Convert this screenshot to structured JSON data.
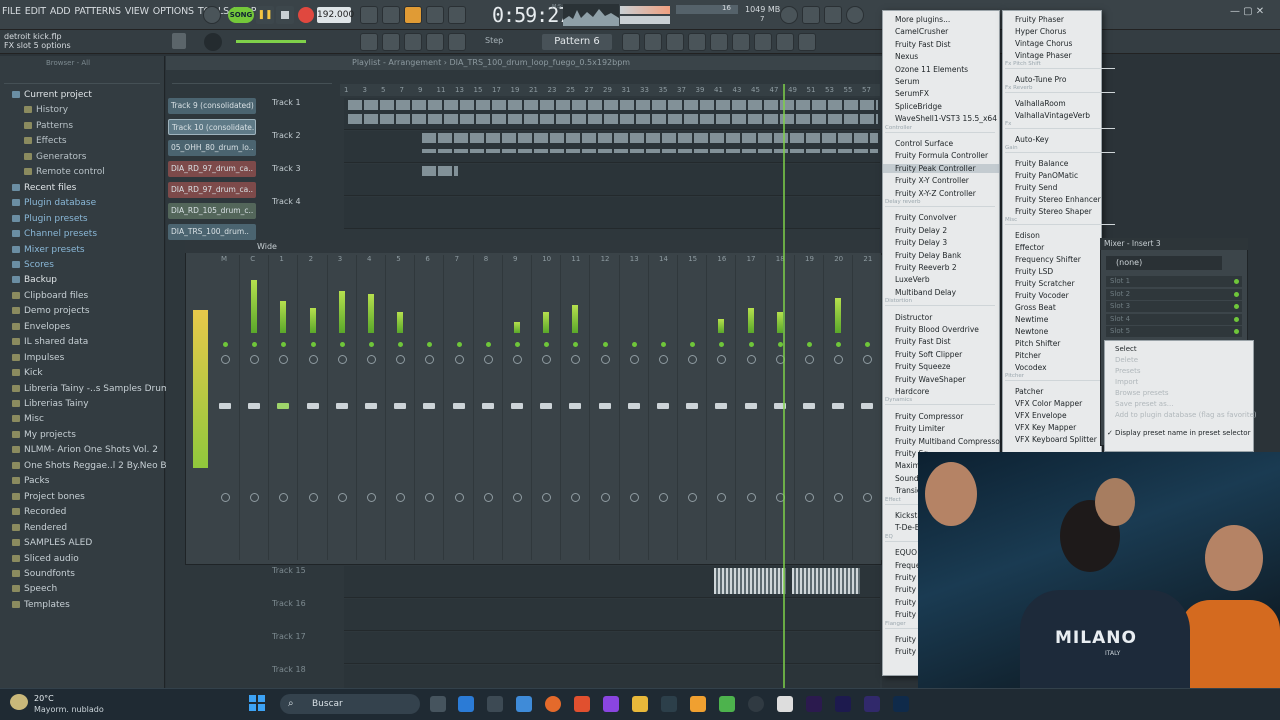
{
  "menu": [
    "FILE",
    "EDIT",
    "ADD",
    "PATTERNS",
    "VIEW",
    "OPTIONS",
    "TOOLS",
    "HELP"
  ],
  "transport": {
    "song_label": "SONG",
    "tempo": "192.000",
    "time": "0:59:27",
    "time_unit": "M:S:CS",
    "memory": "1049 MB",
    "cpu": "16",
    "voices": "7"
  },
  "hints": {
    "line1": "detroit kick.flp",
    "line2": "FX slot 5 options"
  },
  "toolbar": {
    "step_label": "Step",
    "pattern": "Pattern 6"
  },
  "browser": {
    "header": "Browser - All",
    "items": [
      {
        "label": "Current project",
        "type": "top"
      },
      {
        "label": "History",
        "type": "sub"
      },
      {
        "label": "Patterns",
        "type": "sub"
      },
      {
        "label": "Effects",
        "type": "sub"
      },
      {
        "label": "Generators",
        "type": "sub"
      },
      {
        "label": "Remote control",
        "type": "sub"
      },
      {
        "label": "Recent files",
        "type": "top"
      },
      {
        "label": "Plugin database",
        "type": "blue"
      },
      {
        "label": "Plugin presets",
        "type": "blue"
      },
      {
        "label": "Channel presets",
        "type": "blue"
      },
      {
        "label": "Mixer presets",
        "type": "blue"
      },
      {
        "label": "Scores",
        "type": "blue"
      },
      {
        "label": "Backup",
        "type": "top"
      },
      {
        "label": "Clipboard files",
        "type": "item"
      },
      {
        "label": "Demo projects",
        "type": "item"
      },
      {
        "label": "Envelopes",
        "type": "item"
      },
      {
        "label": "IL shared data",
        "type": "item"
      },
      {
        "label": "Impulses",
        "type": "item"
      },
      {
        "label": "Kick",
        "type": "item"
      },
      {
        "label": "Libreria Tainy -..s Samples Drum Kit",
        "type": "item"
      },
      {
        "label": "Librerias Tainy",
        "type": "item"
      },
      {
        "label": "Misc",
        "type": "item"
      },
      {
        "label": "My projects",
        "type": "item"
      },
      {
        "label": "NLMM- Arion One Shots Vol. 2",
        "type": "item"
      },
      {
        "label": "One Shots Reggae..l 2 By.Neo Beats",
        "type": "item"
      },
      {
        "label": "Packs",
        "type": "item"
      },
      {
        "label": "Project bones",
        "type": "item"
      },
      {
        "label": "Recorded",
        "type": "item"
      },
      {
        "label": "Rendered",
        "type": "item"
      },
      {
        "label": "SAMPLES ALED",
        "type": "item"
      },
      {
        "label": "Sliced audio",
        "type": "item"
      },
      {
        "label": "Soundfonts",
        "type": "item"
      },
      {
        "label": "Speech",
        "type": "item"
      },
      {
        "label": "Templates",
        "type": "item"
      }
    ]
  },
  "playlist": {
    "title": "Playlist - Arrangement",
    "file": "DIA_TRS_100_drum_loop_fuego_0.5x192bpm",
    "clips": [
      {
        "label": "Track 9 (consolidated)",
        "color": "blue"
      },
      {
        "label": "Track 10 (consolidate..",
        "color": "sel"
      },
      {
        "label": "05_OHH_80_drum_lo..",
        "color": "blue"
      },
      {
        "label": "DIA_RD_97_drum_ca..",
        "color": "red"
      },
      {
        "label": "DIA_RD_97_drum_ca..",
        "color": "red"
      },
      {
        "label": "DIA_RD_105_drum_c..",
        "color": "green"
      },
      {
        "label": "DIA_TRS_100_drum..",
        "color": "blue"
      }
    ],
    "tracks": [
      "Track 1",
      "Track 2",
      "Track 3",
      "Track 4"
    ],
    "lower_tracks": [
      "Track 15",
      "Track 16",
      "Track 17",
      "Track 18"
    ],
    "ruler": [
      "1",
      "3",
      "5",
      "7",
      "9",
      "11",
      "13",
      "15",
      "17",
      "19",
      "21",
      "23",
      "25",
      "27",
      "29",
      "31",
      "33",
      "35",
      "37",
      "39",
      "41",
      "43",
      "45",
      "47",
      "49",
      "51",
      "53",
      "55",
      "57"
    ]
  },
  "mixer": {
    "mode": "Wide",
    "strip_labels": [
      "M",
      "C",
      "1",
      "2",
      "3",
      "4",
      "5",
      "6",
      "7",
      "8",
      "9",
      "10",
      "11",
      "12",
      "13",
      "14",
      "15",
      "16",
      "17",
      "18",
      "19",
      "20",
      "21",
      "22"
    ]
  },
  "plugin_menu": {
    "col1": [
      {
        "label": "More plugins...",
        "type": "item"
      },
      {
        "label": "CamelCrusher",
        "type": "item"
      },
      {
        "label": "Fruity Fast Dist",
        "type": "item"
      },
      {
        "label": "Nexus",
        "type": "item"
      },
      {
        "label": "Ozone 11 Elements",
        "type": "item"
      },
      {
        "label": "Serum",
        "type": "item"
      },
      {
        "label": "SerumFX",
        "type": "item"
      },
      {
        "label": "SpliceBridge",
        "type": "item"
      },
      {
        "label": "WaveShell1-VST3 15.5_x64",
        "type": "item"
      },
      {
        "label": "Controller",
        "type": "sep"
      },
      {
        "label": "Control Surface",
        "type": "item"
      },
      {
        "label": "Fruity Formula Controller",
        "type": "item"
      },
      {
        "label": "Fruity Peak Controller",
        "type": "hl"
      },
      {
        "label": "Fruity X-Y Controller",
        "type": "item"
      },
      {
        "label": "Fruity X-Y-Z Controller",
        "type": "item"
      },
      {
        "label": "Delay reverb",
        "type": "sep"
      },
      {
        "label": "Fruity Convolver",
        "type": "item"
      },
      {
        "label": "Fruity Delay 2",
        "type": "item"
      },
      {
        "label": "Fruity Delay 3",
        "type": "item"
      },
      {
        "label": "Fruity Delay Bank",
        "type": "item"
      },
      {
        "label": "Fruity Reeverb 2",
        "type": "item"
      },
      {
        "label": "LuxeVerb",
        "type": "item"
      },
      {
        "label": "Multiband Delay",
        "type": "item"
      },
      {
        "label": "Distortion",
        "type": "sep"
      },
      {
        "label": "Distructor",
        "type": "item"
      },
      {
        "label": "Fruity Blood Overdrive",
        "type": "item"
      },
      {
        "label": "Fruity Fast Dist",
        "type": "item"
      },
      {
        "label": "Fruity Soft Clipper",
        "type": "item"
      },
      {
        "label": "Fruity Squeeze",
        "type": "item"
      },
      {
        "label": "Fruity WaveShaper",
        "type": "item"
      },
      {
        "label": "Hardcore",
        "type": "item"
      },
      {
        "label": "Dynamics",
        "type": "sep"
      },
      {
        "label": "Fruity Compressor",
        "type": "item"
      },
      {
        "label": "Fruity Limiter",
        "type": "item"
      },
      {
        "label": "Fruity Multiband Compressor",
        "type": "item"
      },
      {
        "label": "Fruity Sq..",
        "type": "item"
      },
      {
        "label": "Maximus",
        "type": "item"
      },
      {
        "label": "Soundgo..",
        "type": "item"
      },
      {
        "label": "Transient..",
        "type": "item"
      },
      {
        "label": "Effect",
        "type": "sep"
      },
      {
        "label": "Kickstart..",
        "type": "item"
      },
      {
        "label": "T-De-Ess..",
        "type": "item"
      },
      {
        "label": "EQ",
        "type": "sep"
      },
      {
        "label": "EQUO",
        "type": "item"
      },
      {
        "label": "Frequen..",
        "type": "item"
      },
      {
        "label": "Fruity Fi..",
        "type": "item"
      },
      {
        "label": "Fruity Lo..",
        "type": "item"
      },
      {
        "label": "Fruity Pa..",
        "type": "item"
      },
      {
        "label": "Fruity Pa..",
        "type": "item"
      },
      {
        "label": "Flanger",
        "type": "sep"
      },
      {
        "label": "Fruity Fl..",
        "type": "item"
      },
      {
        "label": "Fruity Fl..",
        "type": "item"
      }
    ],
    "col2": [
      {
        "label": "Fruity Phaser",
        "type": "item"
      },
      {
        "label": "Hyper Chorus",
        "type": "item"
      },
      {
        "label": "Vintage Chorus",
        "type": "item"
      },
      {
        "label": "Vintage Phaser",
        "type": "item"
      },
      {
        "label": "Fx Pitch Shift",
        "type": "sep"
      },
      {
        "label": "Auto-Tune Pro",
        "type": "item"
      },
      {
        "label": "Fx Reverb",
        "type": "sep"
      },
      {
        "label": "ValhallaRoom",
        "type": "item"
      },
      {
        "label": "ValhallaVintageVerb",
        "type": "item"
      },
      {
        "label": "Fx",
        "type": "sep"
      },
      {
        "label": "Auto-Key",
        "type": "item"
      },
      {
        "label": "Gain",
        "type": "sep"
      },
      {
        "label": "Fruity Balance",
        "type": "item"
      },
      {
        "label": "Fruity PanOMatic",
        "type": "item"
      },
      {
        "label": "Fruity Send",
        "type": "item"
      },
      {
        "label": "Fruity Stereo Enhancer",
        "type": "item"
      },
      {
        "label": "Fruity Stereo Shaper",
        "type": "item"
      },
      {
        "label": "Misc",
        "type": "sep"
      },
      {
        "label": "Edison",
        "type": "item"
      },
      {
        "label": "Effector",
        "type": "item"
      },
      {
        "label": "Frequency Shifter",
        "type": "item"
      },
      {
        "label": "Fruity LSD",
        "type": "item"
      },
      {
        "label": "Fruity Scratcher",
        "type": "item"
      },
      {
        "label": "Fruity Vocoder",
        "type": "item"
      },
      {
        "label": "Gross Beat",
        "type": "item"
      },
      {
        "label": "Newtime",
        "type": "item"
      },
      {
        "label": "Newtone",
        "type": "item"
      },
      {
        "label": "Pitch Shifter",
        "type": "item"
      },
      {
        "label": "Pitcher",
        "type": "item"
      },
      {
        "label": "Vocodex",
        "type": "item"
      },
      {
        "label": "Pitcher",
        "type": "sep"
      },
      {
        "label": "Patcher",
        "type": "item"
      },
      {
        "label": "VFX Color Mapper",
        "type": "item"
      },
      {
        "label": "VFX Envelope",
        "type": "item"
      },
      {
        "label": "VFX Key Mapper",
        "type": "item"
      },
      {
        "label": "VFX Keyboard Splitter",
        "type": "item"
      }
    ]
  },
  "insert": {
    "title": "Mixer - Insert 3",
    "preset": "(none)",
    "slots": [
      "Slot 1",
      "Slot 2",
      "Slot 3",
      "Slot 4",
      "Slot 5"
    ],
    "context": [
      {
        "label": "Select",
        "dim": false
      },
      {
        "label": "Delete",
        "dim": true
      },
      {
        "label": "Presets",
        "dim": true
      },
      {
        "label": "Import",
        "dim": true
      },
      {
        "label": "Browse presets",
        "dim": true
      },
      {
        "label": "Save preset as...",
        "dim": true
      },
      {
        "label": "Add to plugin database (flag as favorite)",
        "dim": true
      },
      {
        "label": "Display preset name in preset selector",
        "dim": false
      }
    ]
  },
  "webcam": {
    "shirt_text": "MILANO",
    "shirt_sub": "ITALY"
  },
  "taskbar": {
    "temp": "20°C",
    "weather": "Mayorm. nublado",
    "search": "Buscar"
  },
  "colors": {
    "accent": "#7fd14a",
    "playlist_bg": "#2e373c",
    "menu_bg": "#e8eaeb"
  }
}
